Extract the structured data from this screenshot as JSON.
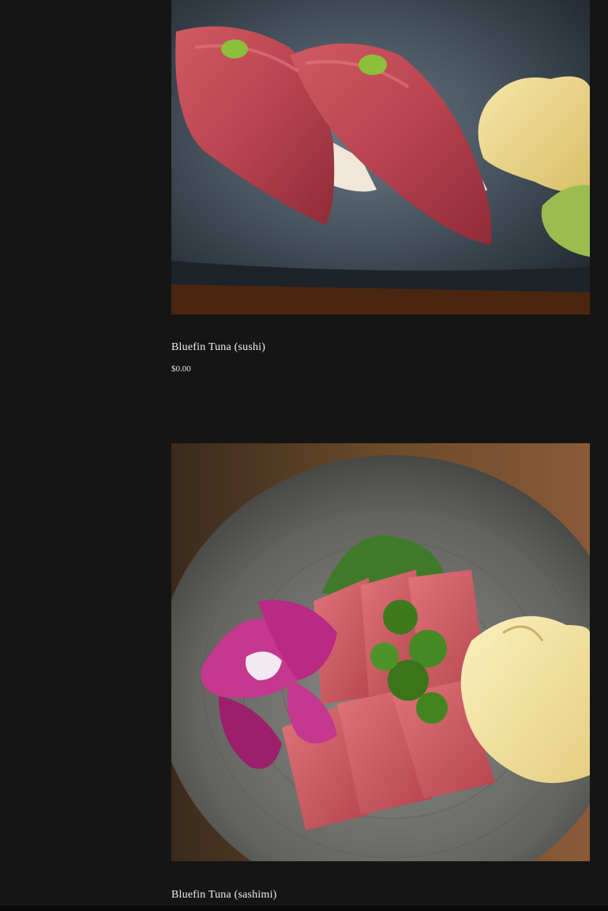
{
  "products": [
    {
      "title": "Bluefin Tuna (sushi)",
      "price": "$0.00",
      "image": "bluefin-tuna-nigiri-photo"
    },
    {
      "title": "Bluefin Tuna (sashimi)",
      "image": "bluefin-tuna-sashimi-photo"
    }
  ],
  "colors": {
    "background": "#151515",
    "text": "#f0f0f0"
  }
}
